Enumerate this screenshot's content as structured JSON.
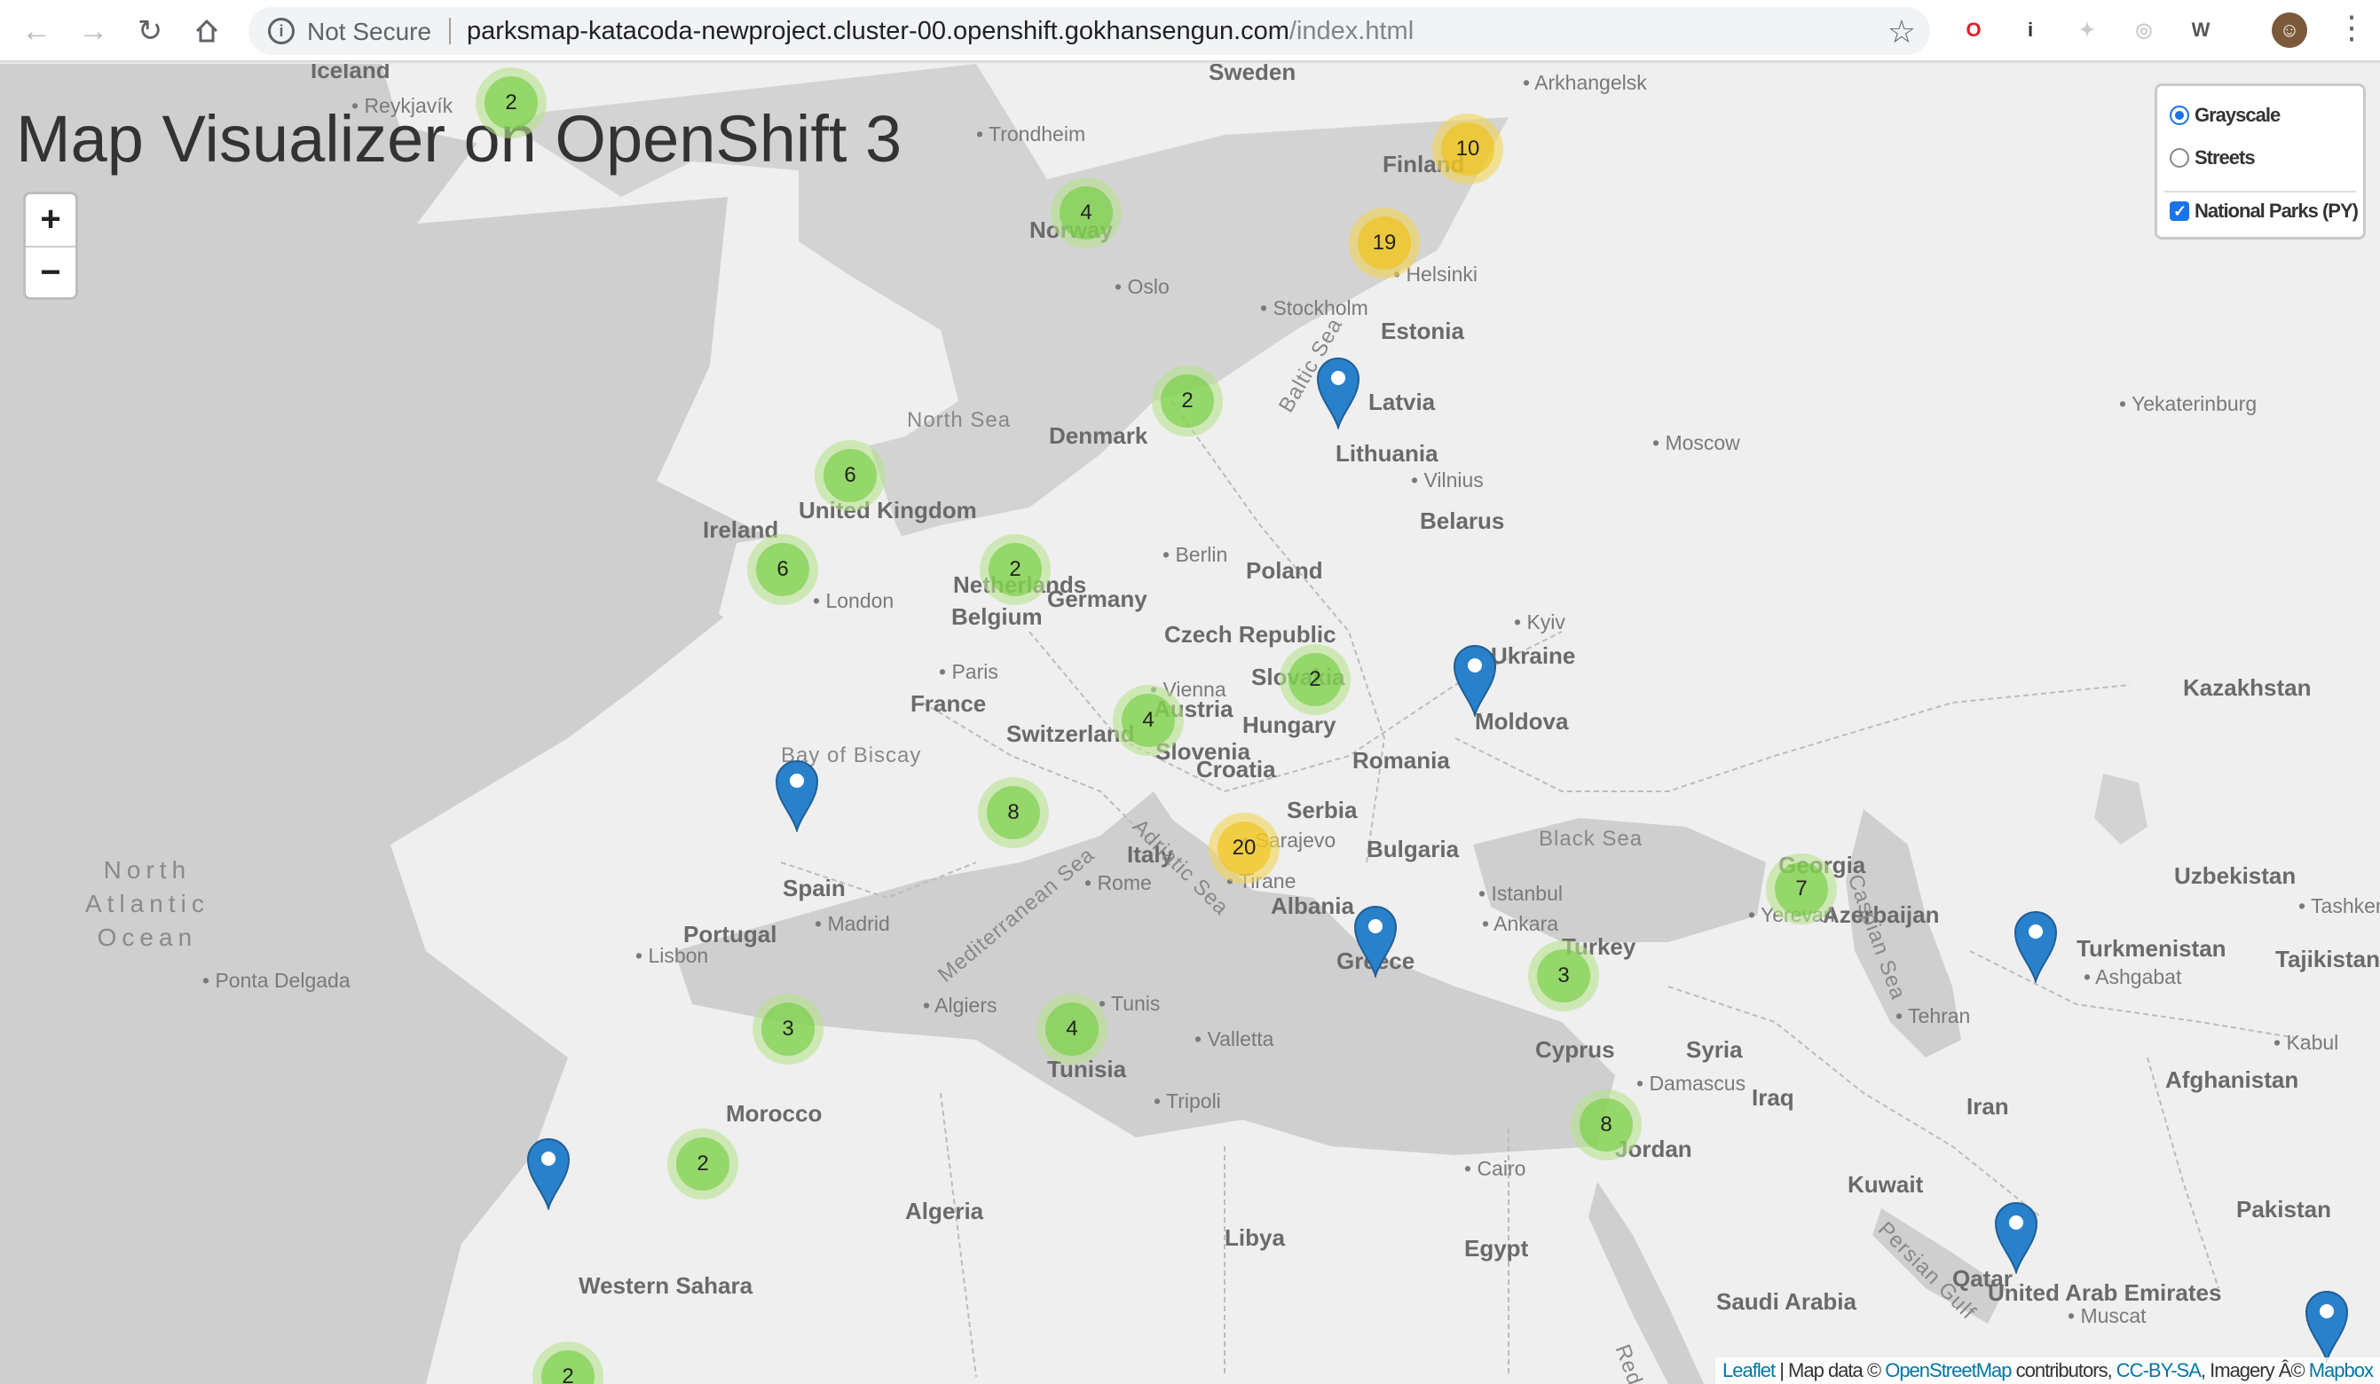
{
  "browser": {
    "back_icon": "arrow-left-icon",
    "forward_icon": "arrow-right-icon",
    "reload_icon": "reload-icon",
    "home_icon": "home-icon",
    "security_label": "Not Secure",
    "url_host": "parksmap-katacoda-newproject.cluster-00.openshift.gokhansengun.com",
    "url_path": "/index.html",
    "extensions": [
      {
        "name": "opera-icon",
        "glyph": "O",
        "color": "#e0202a"
      },
      {
        "name": "onepassword-icon",
        "glyph": "i",
        "color": "#333333"
      },
      {
        "name": "extension-icon",
        "glyph": "✦",
        "color": "#cccccc"
      },
      {
        "name": "target-icon",
        "glyph": "◎",
        "color": "#cccccc"
      },
      {
        "name": "wikipedia-icon",
        "glyph": "W",
        "color": "#555555"
      }
    ]
  },
  "page": {
    "title": "Map Visualizer on OpenShift 3"
  },
  "zoom": {
    "in_label": "+",
    "out_label": "−"
  },
  "layers": {
    "base": [
      {
        "label": "Grayscale",
        "checked": true
      },
      {
        "label": "Streets",
        "checked": false
      }
    ],
    "overlays": [
      {
        "label": "National Parks (PY)",
        "checked": true
      }
    ]
  },
  "map_labels": {
    "countries": [
      "Iceland",
      "Norway",
      "Finland",
      "Sweden",
      "Estonia",
      "Latvia",
      "Lithuania",
      "Denmark",
      "United Kingdom",
      "Ireland",
      "Netherlands",
      "Belgium",
      "Germany",
      "Poland",
      "Belarus",
      "Ukraine",
      "Czech Republic",
      "Slovakia",
      "Austria",
      "Hungary",
      "Moldova",
      "Romania",
      "France",
      "Switzerland",
      "Slovenia",
      "Croatia",
      "Serbia",
      "Bulgaria",
      "Italy",
      "Albania",
      "Greece",
      "Spain",
      "Portugal",
      "Turkey",
      "Georgia",
      "Azerbaijan",
      "Kazakhstan",
      "Uzbekistan",
      "Turkmenistan",
      "Tajikistan",
      "Afghanistan",
      "Pakistan",
      "Iran",
      "Iraq",
      "Syria",
      "Jordan",
      "Kuwait",
      "Qatar",
      "United Arab Emirates",
      "Saudi Arabia",
      "Egypt",
      "Libya",
      "Tunisia",
      "Algeria",
      "Morocco",
      "Western Sahara",
      "Cyprus"
    ],
    "cities": [
      "Reykjavík",
      "Trondheim",
      "Oslo",
      "Stockholm",
      "Helsinki",
      "Arkhangelsk",
      "Moscow",
      "Vilnius",
      "Yekaterinburg",
      "Berlin",
      "London",
      "Paris",
      "Vienna",
      "Kyiv",
      "Rome",
      "Madrid",
      "Lisbon",
      "Tirane",
      "Sarajevo",
      "Istanbul",
      "Ankara",
      "Yerevan",
      "Tehran",
      "Ashgabat",
      "Tashkent",
      "Kabul",
      "Muscat",
      "Damascus",
      "Cairo",
      "Tripoli",
      "Tunis",
      "Algiers",
      "Valletta",
      "Ponta Delgada"
    ],
    "seas": [
      "North Sea",
      "Baltic Sea",
      "Black Sea",
      "Caspian Sea",
      "Mediterranean Sea",
      "Adriatic Sea",
      "Persian Gulf",
      "Red Sea",
      "Bay of Biscay"
    ],
    "ocean": [
      "North",
      "Atlantic",
      "Ocean"
    ]
  },
  "clusters": [
    {
      "count": "2",
      "size": "small"
    },
    {
      "count": "4",
      "size": "small"
    },
    {
      "count": "10",
      "size": "medium"
    },
    {
      "count": "19",
      "size": "medium"
    },
    {
      "count": "2",
      "size": "small"
    },
    {
      "count": "6",
      "size": "small"
    },
    {
      "count": "6",
      "size": "small"
    },
    {
      "count": "2",
      "size": "small"
    },
    {
      "count": "2",
      "size": "small"
    },
    {
      "count": "4",
      "size": "small"
    },
    {
      "count": "8",
      "size": "small"
    },
    {
      "count": "20",
      "size": "medium"
    },
    {
      "count": "7",
      "size": "small"
    },
    {
      "count": "3",
      "size": "small"
    },
    {
      "count": "3",
      "size": "small"
    },
    {
      "count": "4",
      "size": "small"
    },
    {
      "count": "8",
      "size": "small"
    },
    {
      "count": "2",
      "size": "small"
    },
    {
      "count": "2",
      "size": "small"
    }
  ],
  "markers": [
    {
      "name": "Latvia park"
    },
    {
      "name": "Moldova park"
    },
    {
      "name": "Bay of Biscay park"
    },
    {
      "name": "Greece park"
    },
    {
      "name": "Turkmenistan park"
    },
    {
      "name": "Canary Islands park"
    },
    {
      "name": "UAE park"
    },
    {
      "name": "Arabian Sea park"
    }
  ],
  "attribution": {
    "leaflet": "Leaflet",
    "map_data": " | Map data © ",
    "osm": "OpenStreetMap",
    "contributors": " contributors, ",
    "license": "CC-BY-SA",
    "imagery": ", Imagery Â© ",
    "mapbox": "Mapbox"
  },
  "colors": {
    "marker_blue": "#2a81cb",
    "cluster_small": "#6ecc39",
    "cluster_medium": "#f0c20c",
    "water": "#cfcfcf",
    "land": "#efefef"
  }
}
